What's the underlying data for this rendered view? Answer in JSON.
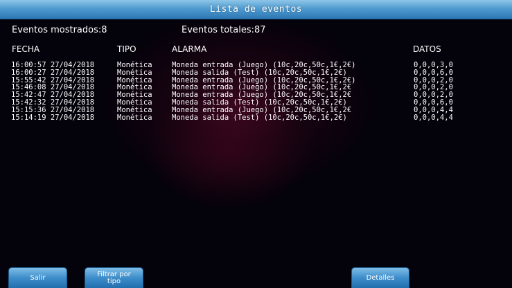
{
  "window": {
    "title": "Lista de eventos"
  },
  "summary": {
    "shown": "Eventos mostrados:8",
    "total": "Eventos totales:87"
  },
  "table": {
    "headers": {
      "fecha": "FECHA",
      "tipo": "TIPO",
      "alarma": "ALARMA",
      "datos": "DATOS"
    },
    "rows": [
      {
        "fecha": "16:00:57 27/04/2018",
        "tipo": "Monética",
        "alarma": "Moneda entrada (Juego) (10c,20c,50c,1€,2€)",
        "datos": "0,0,0,3,0"
      },
      {
        "fecha": "16:00:27 27/04/2018",
        "tipo": "Monética",
        "alarma": "Moneda salida (Test) (10c,20c,50c,1€,2€)",
        "datos": "0,0,0,6,0"
      },
      {
        "fecha": "15:55:42 27/04/2018",
        "tipo": "Monética",
        "alarma": "Moneda entrada (Juego) (10c,20c,50c,1€,2€)",
        "datos": "0,0,0,2,0"
      },
      {
        "fecha": "15:46:08 27/04/2018",
        "tipo": "Monética",
        "alarma": "Moneda entrada (Juego) (10c,20c,50c,1€,2€",
        "datos": "0,0,0,2,0"
      },
      {
        "fecha": "15:42:47 27/04/2018",
        "tipo": "Monética",
        "alarma": "Moneda entrada (Juego) (10c,20c,50c,1€,2€",
        "datos": "0,0,0,2,0"
      },
      {
        "fecha": "15:42:32 27/04/2018",
        "tipo": "Monética",
        "alarma": "Moneda salida (Test) (10c,20c,50c,1€,2€)",
        "datos": "0,0,0,6,0"
      },
      {
        "fecha": "15:15:36 27/04/2018",
        "tipo": "Monética",
        "alarma": "Moneda entrada (Juego) (10c,20c,50c,1€,2€",
        "datos": "0,0,0,4,4"
      },
      {
        "fecha": "15:14:19 27/04/2018",
        "tipo": "Monética",
        "alarma": "Moneda salida (Test) (10c,20c,50c,1€,2€)",
        "datos": "0,0,0,4,4"
      }
    ]
  },
  "buttons": {
    "salir": "Salir",
    "filtrar_line1": "Filtrar por",
    "filtrar_line2": "tipo",
    "detalles": "Detalles"
  },
  "colors": {
    "title_bar": "#4f9bd0",
    "button": "#3d8dcb",
    "background": "#04020a",
    "background_glow": "#5f0a2d",
    "text": "#ffffff"
  }
}
